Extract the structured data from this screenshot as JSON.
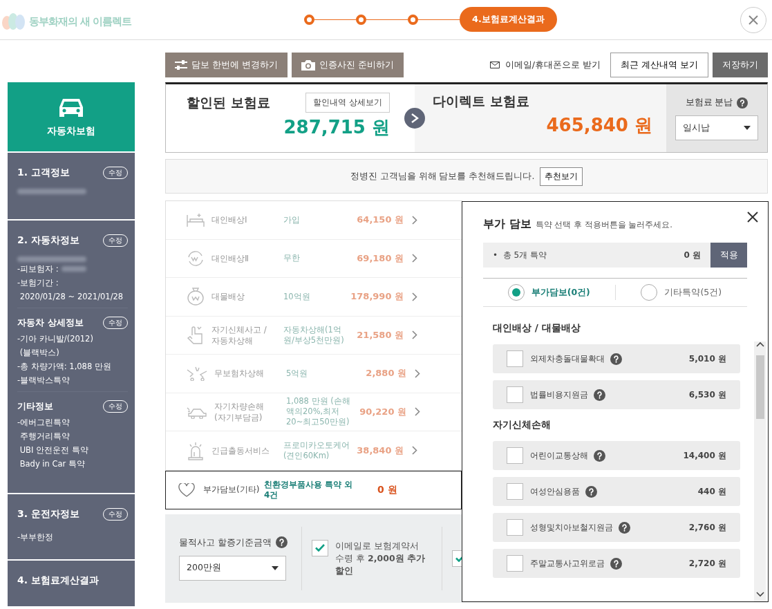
{
  "header": {
    "logo_text": "동부화재의 새 이름렉트",
    "steps": [
      {
        "selected": false
      },
      {
        "selected": false
      },
      {
        "selected": false
      },
      {
        "label": "4.보험료계산결과",
        "selected": true
      }
    ]
  },
  "toolbar": {
    "left_buttons": [
      {
        "label": "담보 한번에 변경하기",
        "kind": "sliders"
      },
      {
        "label": "인증사진 준비하기",
        "kind": "camera"
      }
    ],
    "email_link": "이메일/휴대폰으로 받기",
    "history_button": "최근 계산내역 보기",
    "save_button": "저장하기"
  },
  "sidebar": {
    "product": "자동차보험",
    "sections": [
      {
        "title": "1. 고객정보",
        "edit": "수정",
        "lines": [
          {
            "kind": "redacted"
          }
        ]
      },
      {
        "title": "2. 자동차정보",
        "edit": "수정",
        "lines": [
          {
            "kind": "redacted"
          },
          {
            "kind": "labelled",
            "text": "-피보험자 :"
          },
          {
            "kind": "text",
            "text": "-보험기간 :"
          },
          {
            "kind": "text",
            "text": " 2020/01/28 ~ 2021/01/28"
          }
        ],
        "subsections": [
          {
            "title": "자동차 상세정보",
            "edit": "수정",
            "lines": [
              "-기아 카니발/(2012)",
              " (블랙박스)",
              "-총 차량가액: 1,088 만원",
              "-블랙박스특약"
            ]
          },
          {
            "title": "기타정보",
            "edit": "수정",
            "lines": [
              "-에버그린특약",
              " 주행거리특약",
              " UBI 안전운전 특약",
              " Bady in Car 특약"
            ]
          }
        ]
      },
      {
        "title": "3. 운전자정보",
        "edit": "수정",
        "lines": [
          {
            "kind": "text",
            "text": "-부부한정"
          }
        ]
      },
      {
        "title": "4. 보험료계산결과"
      }
    ]
  },
  "summary": {
    "discount_title": "할인된 보험료",
    "detail_button": "할인내역 상세보기",
    "discount_amount": "287,715 원",
    "direct_title": "다이렉트 보험료",
    "direct_amount": "465,840 원",
    "installment_label": "보험료 분납",
    "installment_value": "일시납"
  },
  "recommend": {
    "text": "정병진 고객님을 위해 담보를 추천해드립니다.",
    "button": "추천보기"
  },
  "coverages": [
    {
      "name": "대인배상Ⅰ",
      "value": "가입",
      "price": "64,150 원"
    },
    {
      "name": "대인배상Ⅱ",
      "value": "무한",
      "price": "69,180 원"
    },
    {
      "name": "대물배상",
      "value": "10억원",
      "price": "178,990 원"
    },
    {
      "name": "자기신체사고 /자동차상해",
      "value": "자동차상해(1억원/부상5천만원)",
      "price": "21,580 원"
    },
    {
      "name": "무보험차상해",
      "value": "5억원",
      "price": "2,880 원"
    },
    {
      "name": "자기차량손해 (자기부담금)",
      "value": "1,088 만원 (손해액의20%,최저20~최고50만원)",
      "price": "90,220 원"
    },
    {
      "name": "긴급출동서비스",
      "value": "프로미카오토케어(견인60Km)",
      "price": "38,840 원"
    }
  ],
  "extra": {
    "name": "부가담보(기타)",
    "value": "친환경부품사용 특약 외 4건",
    "price": "0 원"
  },
  "options": {
    "surcharge_label": "물적사고 할증기준금액",
    "surcharge_value": "200만원",
    "checks": [
      {
        "text": "이메일로 보험계약서 수령 후 **2,000원 추가 할인**",
        "checked": true
      },
      {
        "checked": true
      }
    ]
  },
  "popup": {
    "title": "부가 담보",
    "hint": "특약 선택 후 적용버튼을 눌러주세요.",
    "total": "•  총 5개 특약",
    "total_amount": "0 원",
    "apply": "적용",
    "tabs": [
      {
        "label": "부가담보(0건)",
        "selected": true
      },
      {
        "label": "기타특약(5건)",
        "selected": false
      }
    ],
    "groups": [
      {
        "title": "대인배상 / 대물배상",
        "items": [
          {
            "name": "외제차충돌대물확대",
            "price": "5,010 원",
            "checked": false
          },
          {
            "name": "법률비용지원금",
            "price": "6,530 원",
            "checked": false
          }
        ]
      },
      {
        "title": "자기신체손해",
        "items": [
          {
            "name": "어린이교통상해",
            "price": "14,400 원",
            "checked": false
          },
          {
            "name": "여성안심용품",
            "price": "440 원",
            "checked": false
          },
          {
            "name": "성형및치아보철지원금",
            "price": "2,760 원",
            "checked": false
          },
          {
            "name": "주말교통사고위로금",
            "price": "2,720 원",
            "checked": false
          }
        ]
      }
    ]
  }
}
